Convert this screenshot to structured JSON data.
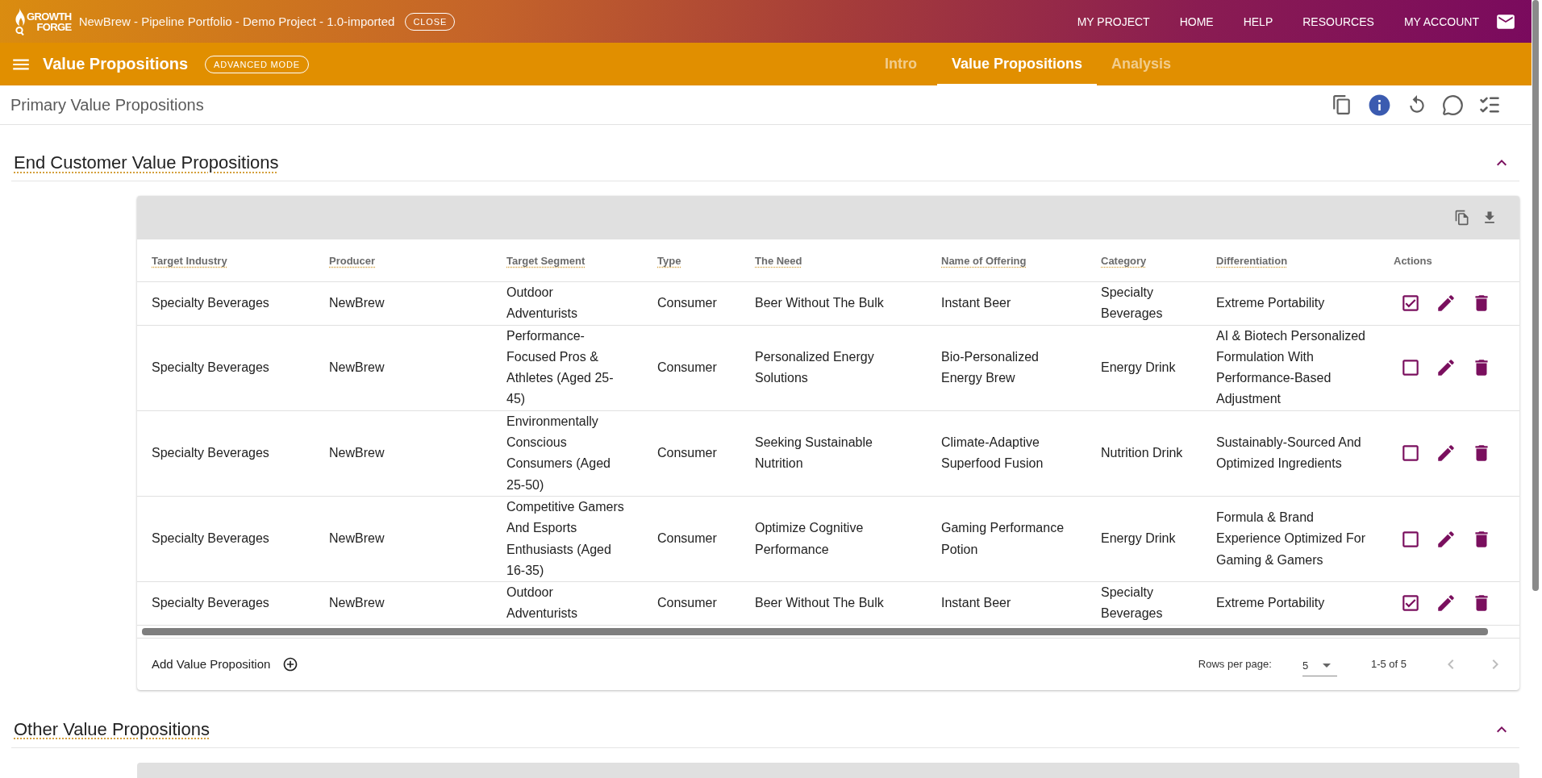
{
  "app_bar": {
    "logo": {
      "line_1": "GROWTH",
      "line_2": "FORGE"
    },
    "project_title": "NewBrew - Pipeline Portfolio - Demo Project - 1.0-imported",
    "close_label": "CLOSE",
    "nav": [
      "MY PROJECT",
      "HOME",
      "HELP",
      "RESOURCES",
      "MY ACCOUNT"
    ]
  },
  "page_bar": {
    "title": "Value Propositions",
    "mode_label": "ADVANCED MODE",
    "tabs": [
      {
        "label": "Intro",
        "selected": false
      },
      {
        "label": "Value Propositions",
        "selected": true
      },
      {
        "label": "Analysis",
        "selected": false
      }
    ]
  },
  "sub_header": {
    "title": "Primary Value Propositions"
  },
  "sections": [
    {
      "title": "End Customer Value Propositions",
      "expanded": true,
      "table": {
        "columns": [
          {
            "label": "Target Industry",
            "kind": "data"
          },
          {
            "label": "Producer",
            "kind": "data"
          },
          {
            "label": "Target Segment",
            "kind": "data"
          },
          {
            "label": "Type",
            "kind": "data"
          },
          {
            "label": "The Need",
            "kind": "data"
          },
          {
            "label": "Name of Offering",
            "kind": "data"
          },
          {
            "label": "Category",
            "kind": "data"
          },
          {
            "label": "Differentiation",
            "kind": "data"
          },
          {
            "label": "Actions",
            "kind": "actions"
          }
        ],
        "rows": [
          {
            "cells": [
              "Specialty Beverages",
              "NewBrew",
              "Outdoor Adventurists",
              "Consumer",
              "Beer Without The Bulk",
              "Instant Beer",
              "Specialty Beverages",
              "Extreme Portability"
            ],
            "checked": true
          },
          {
            "cells": [
              "Specialty Beverages",
              "NewBrew",
              "Performance-Focused Pros & Athletes (Aged 25-45)",
              "Consumer",
              "Personalized Energy Solutions",
              "Bio-Personalized Energy Brew",
              "Energy Drink",
              "AI & Biotech Personalized Formulation With Performance-Based Adjustment"
            ],
            "checked": false
          },
          {
            "cells": [
              "Specialty Beverages",
              "NewBrew",
              "Environmentally Conscious Consumers (Aged 25-50)",
              "Consumer",
              "Seeking Sustainable Nutrition",
              "Climate-Adaptive Superfood Fusion",
              "Nutrition Drink",
              "Sustainably-Sourced And Optimized Ingredients"
            ],
            "checked": false
          },
          {
            "cells": [
              "Specialty Beverages",
              "NewBrew",
              "Competitive Gamers And Esports Enthusiasts (Aged 16-35)",
              "Consumer",
              "Optimize Cognitive Performance",
              "Gaming Performance Potion",
              "Energy Drink",
              "Formula & Brand Experience Optimized For Gaming & Gamers"
            ],
            "checked": false
          },
          {
            "cells": [
              "Specialty Beverages",
              "NewBrew",
              "Outdoor Adventurists",
              "Consumer",
              "Beer Without The Bulk",
              "Instant Beer",
              "Specialty Beverages",
              "Extreme Portability"
            ],
            "checked": true
          }
        ],
        "add_label": "Add Value Proposition",
        "rows_per_page_label": "Rows per page:",
        "rows_per_page": "5",
        "range": "1-5 of 5",
        "prev_disabled": true,
        "next_disabled": true
      }
    },
    {
      "title": "Other Value Propositions",
      "expanded": true
    }
  ]
}
